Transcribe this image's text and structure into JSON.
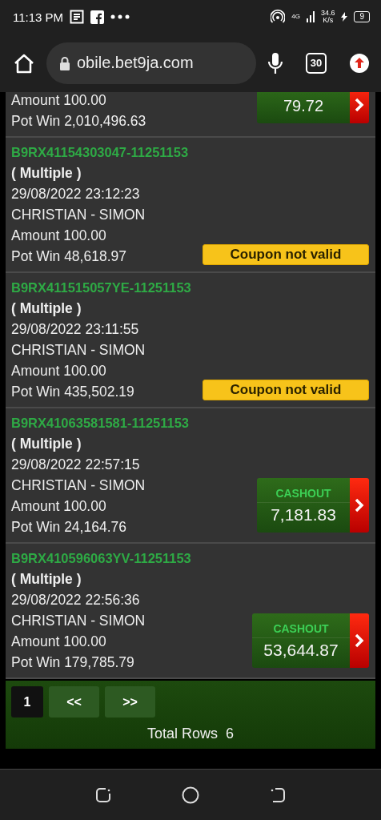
{
  "status_bar": {
    "time": "11:13 PM",
    "network": "4G",
    "speed": "34.6",
    "speed_unit": "K/s",
    "battery": "9"
  },
  "browser": {
    "url": "obile.bet9ja.com",
    "tab_count": "30"
  },
  "bets": [
    {
      "amount": "Amount 100.00",
      "pot_win": "Pot Win 2,010,496.63",
      "action": {
        "kind": "value",
        "value": "79.72"
      }
    },
    {
      "id": "B9RX41154303047-11251153",
      "type": "( Multiple )",
      "date": "29/08/2022 23:12:23",
      "match": "CHRISTIAN - SIMON",
      "amount": "Amount 100.00",
      "pot_win": "Pot Win 48,618.97",
      "action": {
        "kind": "invalid",
        "label": "Coupon not valid"
      }
    },
    {
      "id": "B9RX411515057YE-11251153",
      "type": "( Multiple )",
      "date": "29/08/2022 23:11:55",
      "match": "CHRISTIAN - SIMON",
      "amount": "Amount 100.00",
      "pot_win": "Pot Win 435,502.19",
      "action": {
        "kind": "invalid",
        "label": "Coupon not valid"
      }
    },
    {
      "id": "B9RX41063581581-11251153",
      "type": "( Multiple )",
      "date": "29/08/2022 22:57:15",
      "match": "CHRISTIAN - SIMON",
      "amount": "Amount 100.00",
      "pot_win": "Pot Win 24,164.76",
      "action": {
        "kind": "cashout",
        "label": "CASHOUT",
        "value": "7,181.83"
      }
    },
    {
      "id": "B9RX410596063YV-11251153",
      "type": "( Multiple )",
      "date": "29/08/2022 22:56:36",
      "match": "CHRISTIAN - SIMON",
      "amount": "Amount 100.00",
      "pot_win": "Pot Win 179,785.79",
      "action": {
        "kind": "cashout",
        "label": "CASHOUT",
        "value": "53,644.87"
      }
    }
  ],
  "pagination": {
    "pages": [
      {
        "label": "1",
        "selected": true
      }
    ],
    "prev": "<<",
    "next": ">>",
    "total_label": "Total Rows",
    "total": "6"
  }
}
